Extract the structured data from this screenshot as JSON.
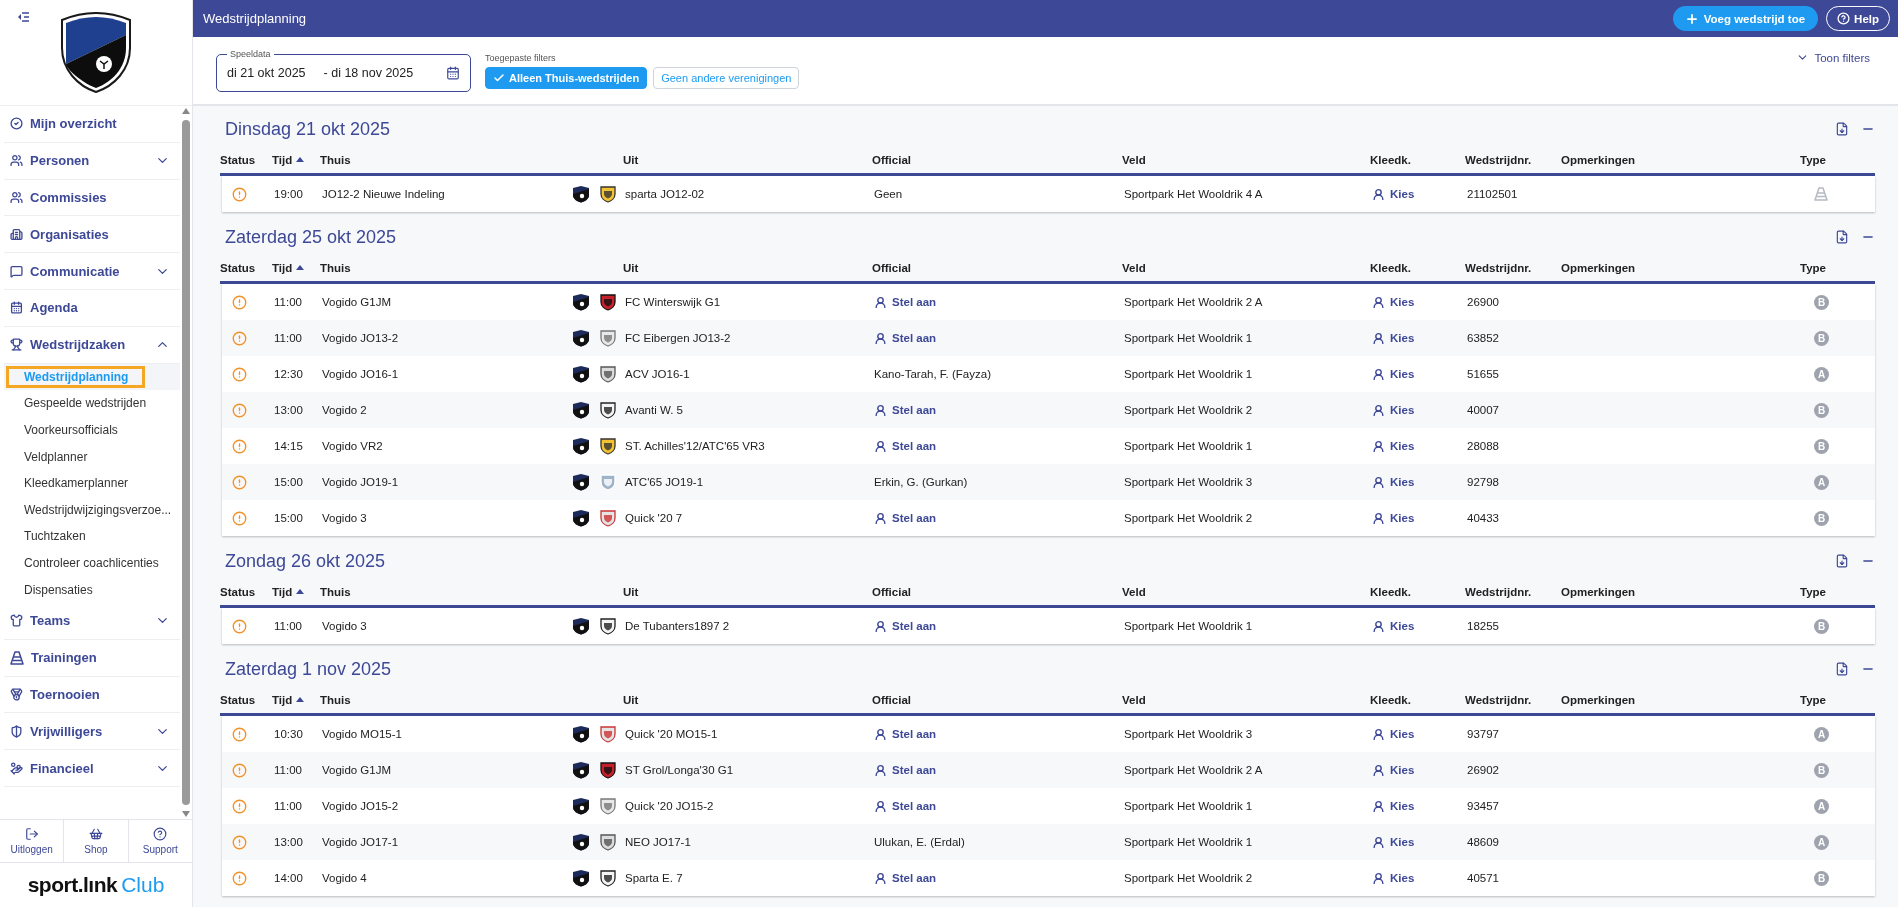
{
  "sidebar": {
    "items": [
      {
        "kind": "link",
        "label": "Mijn overzicht"
      },
      {
        "kind": "group",
        "label": "Personen",
        "expanded": false
      },
      {
        "kind": "link",
        "label": "Commissies"
      },
      {
        "kind": "link",
        "label": "Organisaties"
      },
      {
        "kind": "group",
        "label": "Communicatie",
        "expanded": false
      },
      {
        "kind": "link",
        "label": "Agenda"
      },
      {
        "kind": "group",
        "label": "Wedstrijdzaken",
        "expanded": true,
        "children": [
          {
            "label": "Wedstrijdplanning",
            "selected": true
          },
          {
            "label": "Gespeelde wedstrijden",
            "selected": false
          },
          {
            "label": "Voorkeursofficials",
            "selected": false
          },
          {
            "label": "Veldplanner",
            "selected": false
          },
          {
            "label": "Kleedkamerplanner",
            "selected": false
          },
          {
            "label": "Wedstrijdwijzigingsverzoe...",
            "selected": false
          },
          {
            "label": "Tuchtzaken",
            "selected": false
          },
          {
            "label": "Controleer coachlicenties",
            "selected": false
          },
          {
            "label": "Dispensaties",
            "selected": false
          }
        ]
      },
      {
        "kind": "group",
        "label": "Teams",
        "expanded": false
      },
      {
        "kind": "link",
        "label": "Trainingen"
      },
      {
        "kind": "link",
        "label": "Toernooien"
      },
      {
        "kind": "group",
        "label": "Vrijwilligers",
        "expanded": false
      },
      {
        "kind": "group",
        "label": "Financieel",
        "expanded": false
      }
    ],
    "footer_buttons": [
      "Uitloggen",
      "Shop",
      "Support"
    ],
    "brand": {
      "name": "sport.lınk",
      "suffix": "Club"
    }
  },
  "header": {
    "title": "Wedstrijdplanning",
    "add_button": "Voeg wedstrijd toe",
    "help_button": "Help"
  },
  "filters": {
    "date_label": "Speeldata",
    "date_from": "di 21 okt 2025",
    "date_to": "- di 18 nov 2025",
    "applied_label": "Toegepaste filters",
    "chips": [
      {
        "label": "Alleen Thuis-wedstrijden",
        "selected": true
      },
      {
        "label": "Geen andere verenigingen",
        "selected": false
      }
    ],
    "toggle": "Toon filters"
  },
  "days": [
    {
      "title": "Dinsdag 21 okt 2025",
      "columns": [
        {
          "label": "Status",
          "sorted": false
        },
        {
          "label": "Tijd",
          "sorted": true
        },
        {
          "label": "Thuis",
          "sorted": false
        },
        {
          "label": "Uit",
          "sorted": false
        },
        {
          "label": "Official",
          "sorted": false
        },
        {
          "label": "Veld",
          "sorted": false
        },
        {
          "label": "Kleedk.",
          "sorted": false
        },
        {
          "label": "Wedstrijdnr.",
          "sorted": false
        },
        {
          "label": "Opmerkingen",
          "sorted": false
        },
        {
          "label": "Type",
          "sorted": false
        }
      ],
      "rows": [
        {
          "time": "19:00",
          "home": "JO12-2 Nieuwe Indeling",
          "away": "sparta JO12-02",
          "official": {
            "kind": "name",
            "text": "Geen"
          },
          "field": "Sportpark Het Wooldrik 4 A",
          "dressing": "Kies",
          "number": "21102501",
          "type": {
            "kind": "cone"
          }
        }
      ]
    },
    {
      "title": "Zaterdag 25 okt 2025",
      "columns": [
        {
          "label": "Status",
          "sorted": false
        },
        {
          "label": "Tijd",
          "sorted": true
        },
        {
          "label": "Thuis",
          "sorted": false
        },
        {
          "label": "Uit",
          "sorted": false
        },
        {
          "label": "Official",
          "sorted": false
        },
        {
          "label": "Veld",
          "sorted": false
        },
        {
          "label": "Kleedk.",
          "sorted": false
        },
        {
          "label": "Wedstrijdnr.",
          "sorted": false
        },
        {
          "label": "Opmerkingen",
          "sorted": false
        },
        {
          "label": "Type",
          "sorted": false
        }
      ],
      "rows": [
        {
          "time": "11:00",
          "home": "Vogido G1JM",
          "away": "FC Winterswijk G1",
          "official": {
            "kind": "assign",
            "text": "Stel aan"
          },
          "field": "Sportpark Het Wooldrik 2 A",
          "dressing": "Kies",
          "number": "26900",
          "type": {
            "kind": "letter",
            "label": "B"
          }
        },
        {
          "time": "11:00",
          "home": "Vogido JO13-2",
          "away": "FC Eibergen JO13-2",
          "official": {
            "kind": "assign",
            "text": "Stel aan"
          },
          "field": "Sportpark Het Wooldrik 1",
          "dressing": "Kies",
          "number": "63852",
          "type": {
            "kind": "letter",
            "label": "B"
          }
        },
        {
          "time": "12:30",
          "home": "Vogido JO16-1",
          "away": "ACV JO16-1",
          "official": {
            "kind": "name",
            "text": "Kano-Tarah, F. (Fayza)"
          },
          "field": "Sportpark Het Wooldrik 1",
          "dressing": "Kies",
          "number": "51655",
          "type": {
            "kind": "letter",
            "label": "A"
          }
        },
        {
          "time": "13:00",
          "home": "Vogido 2",
          "away": "Avanti W. 5",
          "official": {
            "kind": "assign",
            "text": "Stel aan"
          },
          "field": "Sportpark Het Wooldrik 2",
          "dressing": "Kies",
          "number": "40007",
          "type": {
            "kind": "letter",
            "label": "B"
          }
        },
        {
          "time": "14:15",
          "home": "Vogido VR2",
          "away": "ST. Achilles'12/ATC'65 VR3",
          "official": {
            "kind": "assign",
            "text": "Stel aan"
          },
          "field": "Sportpark Het Wooldrik 1",
          "dressing": "Kies",
          "number": "28088",
          "type": {
            "kind": "letter",
            "label": "B"
          }
        },
        {
          "time": "15:00",
          "home": "Vogido JO19-1",
          "away": "ATC'65 JO19-1",
          "official": {
            "kind": "name",
            "text": "Erkin, G. (Gurkan)"
          },
          "field": "Sportpark Het Wooldrik 3",
          "dressing": "Kies",
          "number": "92798",
          "type": {
            "kind": "letter",
            "label": "A"
          }
        },
        {
          "time": "15:00",
          "home": "Vogido 3",
          "away": "Quick '20 7",
          "official": {
            "kind": "assign",
            "text": "Stel aan"
          },
          "field": "Sportpark Het Wooldrik 2",
          "dressing": "Kies",
          "number": "40433",
          "type": {
            "kind": "letter",
            "label": "B"
          }
        }
      ]
    },
    {
      "title": "Zondag 26 okt 2025",
      "columns": [
        {
          "label": "Status",
          "sorted": false
        },
        {
          "label": "Tijd",
          "sorted": true
        },
        {
          "label": "Thuis",
          "sorted": false
        },
        {
          "label": "Uit",
          "sorted": false
        },
        {
          "label": "Official",
          "sorted": false
        },
        {
          "label": "Veld",
          "sorted": false
        },
        {
          "label": "Kleedk.",
          "sorted": false
        },
        {
          "label": "Wedstrijdnr.",
          "sorted": false
        },
        {
          "label": "Opmerkingen",
          "sorted": false
        },
        {
          "label": "Type",
          "sorted": false
        }
      ],
      "rows": [
        {
          "time": "11:00",
          "home": "Vogido 3",
          "away": "De Tubanters1897 2",
          "official": {
            "kind": "assign",
            "text": "Stel aan"
          },
          "field": "Sportpark Het Wooldrik 1",
          "dressing": "Kies",
          "number": "18255",
          "type": {
            "kind": "letter",
            "label": "B"
          }
        }
      ]
    },
    {
      "title": "Zaterdag 1 nov 2025",
      "columns": [
        {
          "label": "Status",
          "sorted": false
        },
        {
          "label": "Tijd",
          "sorted": true
        },
        {
          "label": "Thuis",
          "sorted": false
        },
        {
          "label": "Uit",
          "sorted": false
        },
        {
          "label": "Official",
          "sorted": false
        },
        {
          "label": "Veld",
          "sorted": false
        },
        {
          "label": "Kleedk.",
          "sorted": false
        },
        {
          "label": "Wedstrijdnr.",
          "sorted": false
        },
        {
          "label": "Opmerkingen",
          "sorted": false
        },
        {
          "label": "Type",
          "sorted": false
        }
      ],
      "rows": [
        {
          "time": "10:30",
          "home": "Vogido MO15-1",
          "away": "Quick '20 MO15-1",
          "official": {
            "kind": "assign",
            "text": "Stel aan"
          },
          "field": "Sportpark Het Wooldrik 3",
          "dressing": "Kies",
          "number": "93797",
          "type": {
            "kind": "letter",
            "label": "A"
          }
        },
        {
          "time": "11:00",
          "home": "Vogido G1JM",
          "away": "ST Grol/Longa'30 G1",
          "official": {
            "kind": "assign",
            "text": "Stel aan"
          },
          "field": "Sportpark Het Wooldrik 2 A",
          "dressing": "Kies",
          "number": "26902",
          "type": {
            "kind": "letter",
            "label": "B"
          }
        },
        {
          "time": "11:00",
          "home": "Vogido JO15-2",
          "away": "Quick '20 JO15-2",
          "official": {
            "kind": "assign",
            "text": "Stel aan"
          },
          "field": "Sportpark Het Wooldrik 1",
          "dressing": "Kies",
          "number": "93457",
          "type": {
            "kind": "letter",
            "label": "A"
          }
        },
        {
          "time": "13:00",
          "home": "Vogido JO17-1",
          "away": "NEO JO17-1",
          "official": {
            "kind": "name",
            "text": "Ulukan, E. (Erdal)"
          },
          "field": "Sportpark Het Wooldrik 1",
          "dressing": "Kies",
          "number": "48609",
          "type": {
            "kind": "letter",
            "label": "A"
          }
        },
        {
          "time": "14:00",
          "home": "Vogido 4",
          "away": "Sparta E. 7",
          "official": {
            "kind": "assign",
            "text": "Stel aan"
          },
          "field": "Sportpark Het Wooldrik 2",
          "dressing": "Kies",
          "number": "40571",
          "type": {
            "kind": "letter",
            "label": "B"
          }
        }
      ]
    }
  ]
}
